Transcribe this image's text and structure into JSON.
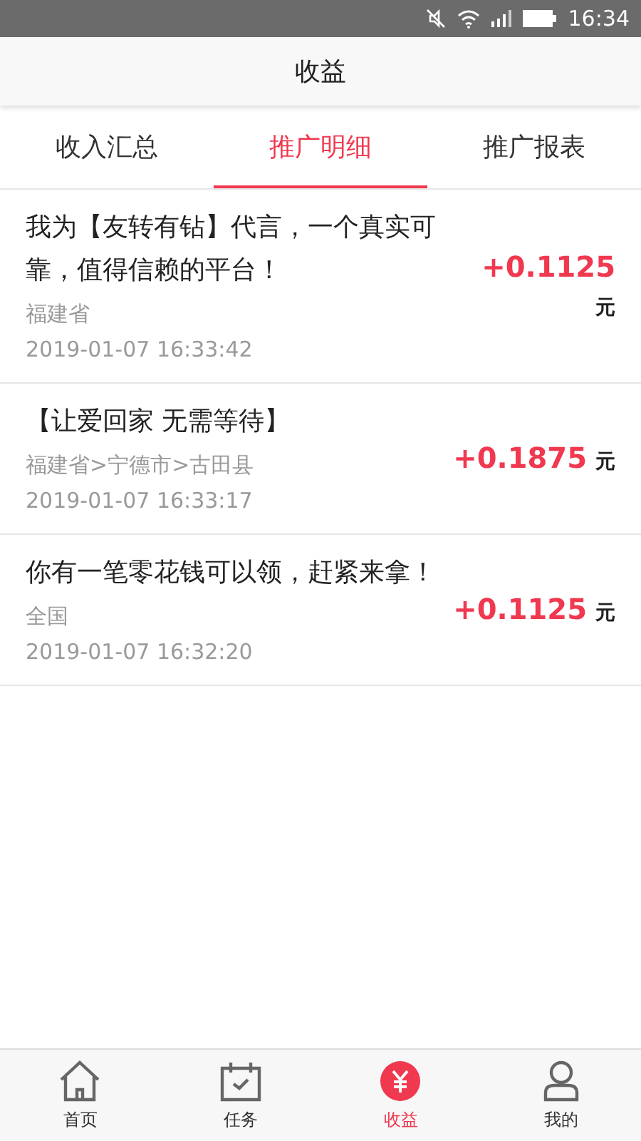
{
  "status_bar": {
    "time": "16:34"
  },
  "header": {
    "title": "收益"
  },
  "tabs": [
    {
      "label": "收入汇总",
      "selected": false
    },
    {
      "label": "推广明细",
      "selected": true
    },
    {
      "label": "推广报表",
      "selected": false
    }
  ],
  "records": [
    {
      "title": "我为【友转有钻】代言，一个真实可靠，值得信赖的平台！",
      "region": "福建省",
      "time": "2019-01-07 16:33:42",
      "amount": "+0.1125",
      "unit": "元"
    },
    {
      "title": "【让爱回家 无需等待】",
      "region": "福建省>宁德市>古田县",
      "time": "2019-01-07 16:33:17",
      "amount": "+0.1875",
      "unit": "元"
    },
    {
      "title": "你有一笔零花钱可以领，赶紧来拿！",
      "region": "全国",
      "time": "2019-01-07 16:32:20",
      "amount": "+0.1125",
      "unit": "元"
    }
  ],
  "nav": [
    {
      "kind": "home",
      "label": "首页",
      "selected": false
    },
    {
      "kind": "task",
      "label": "任务",
      "selected": false
    },
    {
      "kind": "income",
      "label": "收益",
      "selected": true
    },
    {
      "kind": "mine",
      "label": "我的",
      "selected": false
    }
  ]
}
